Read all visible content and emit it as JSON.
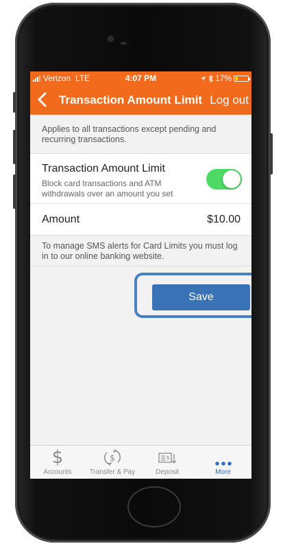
{
  "status_bar": {
    "carrier": "Verizon",
    "network": "LTE",
    "time": "4:07 PM",
    "battery": "17%"
  },
  "nav": {
    "title": "Transaction Amount Limit",
    "logout_label": "Log out"
  },
  "applies_note": "Applies to all transactions except pending and recurring transactions.",
  "transaction_limit": {
    "title": "Transaction Amount Limit",
    "subtitle": "Block card transactions and ATM withdrawals over an amount you set",
    "enabled": true
  },
  "amount": {
    "label": "Amount",
    "value": "$10.00"
  },
  "sms_note": "To manage SMS alerts for Card Limits you must log in to our online banking website.",
  "save_label": "Save",
  "tabs": [
    {
      "label": "Accounts",
      "icon": "dollar-icon"
    },
    {
      "label": "Transfer & Pay",
      "icon": "transfer-pay-icon"
    },
    {
      "label": "Deposit",
      "icon": "deposit-check-icon"
    },
    {
      "label": "More",
      "icon": "more-icon"
    }
  ],
  "colors": {
    "brand_orange": "#f26b1d",
    "button_blue": "#3a73b5",
    "toggle_green": "#4cd964",
    "active_tab_blue": "#2f6fc0"
  }
}
